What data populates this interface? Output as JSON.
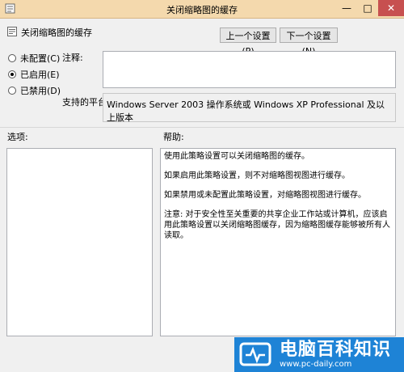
{
  "window": {
    "title": "关闭缩略图的缓存",
    "min": "—",
    "max": "□",
    "close": "✕"
  },
  "header": {
    "policy_name": "关闭缩略图的缓存",
    "prev_button": "上一个设置(P)",
    "next_button": "下一个设置(N)"
  },
  "state": {
    "options": [
      {
        "label": "未配置(C)",
        "checked": false
      },
      {
        "label": "已启用(E)",
        "checked": true
      },
      {
        "label": "已禁用(D)",
        "checked": false
      }
    ]
  },
  "comment": {
    "label": "注释:",
    "value": ""
  },
  "platform": {
    "label": "支持的平台:",
    "value": "Windows Server 2003 操作系统或 Windows XP Professional 及以上版本"
  },
  "options_section": {
    "label": "选项:"
  },
  "help_section": {
    "label": "帮助:",
    "paragraphs": [
      "使用此策略设置可以关闭缩略图的缓存。",
      "如果启用此策略设置，则不对缩略图视图进行缓存。",
      "如果禁用或未配置此策略设置，对缩略图视图进行缓存。",
      "注意: 对于安全性至关重要的共享企业工作站或计算机，应该启用此策略设置以关闭缩略图缓存，因为缩略图缓存能够被所有人读取。"
    ]
  },
  "watermark": {
    "main": "电脑百科知识",
    "sub": "www.pc-daily.com"
  }
}
